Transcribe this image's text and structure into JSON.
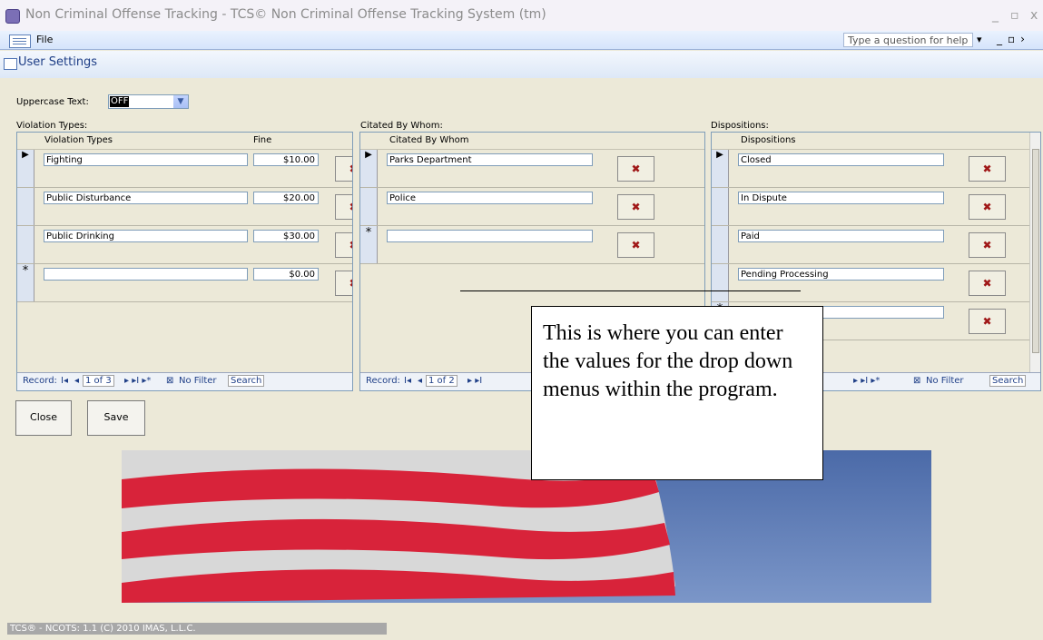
{
  "window": {
    "title": "Non Criminal Offense Tracking - TCS© Non Criminal Offense Tracking System (tm)"
  },
  "menu": {
    "file_label": "File",
    "help_placeholder": "Type a question for help"
  },
  "form": {
    "title": "User Settings"
  },
  "uppercase": {
    "label": "Uppercase Text:",
    "value": "OFF"
  },
  "violation": {
    "section_label": "Violation Types:",
    "col_type": "Violation Types",
    "col_fine": "Fine",
    "rows": [
      {
        "type": "Fighting",
        "fine": "$10.00"
      },
      {
        "type": "Public Disturbance",
        "fine": "$20.00"
      },
      {
        "type": "Public Drinking",
        "fine": "$30.00"
      },
      {
        "type": "",
        "fine": "$0.00"
      }
    ],
    "nav": {
      "record_label": "Record:",
      "position": "1 of 3",
      "filter": "No Filter",
      "search": "Search"
    }
  },
  "cited": {
    "section_label": "Citated By Whom:",
    "col": "Citated By Whom",
    "rows": [
      {
        "name": "Parks Department"
      },
      {
        "name": "Police"
      },
      {
        "name": ""
      }
    ],
    "nav": {
      "record_label": "Record:",
      "position": "1 of 2"
    }
  },
  "dispositions": {
    "section_label": "Dispositions:",
    "col": "Dispositions",
    "rows": [
      {
        "name": "Closed"
      },
      {
        "name": "In Dispute"
      },
      {
        "name": "Paid"
      },
      {
        "name": "Pending Processing"
      },
      {
        "name": ""
      }
    ],
    "nav": {
      "filter": "No Filter",
      "search": "Search"
    }
  },
  "buttons": {
    "close": "Close",
    "save": "Save"
  },
  "callout": {
    "text": "This is where you can enter the values for the drop down menus within the program."
  },
  "status": {
    "text": "TCS® - NCOTS: 1.1  (C) 2010 IMAS, L.L.C."
  },
  "glyphs": {
    "current_row": "▶",
    "new_row": "*",
    "delete": "✖"
  },
  "colors": {
    "flag_red": "#d8233a",
    "flag_white": "#d9d9d9",
    "flag_blue": "#5b79b9"
  }
}
